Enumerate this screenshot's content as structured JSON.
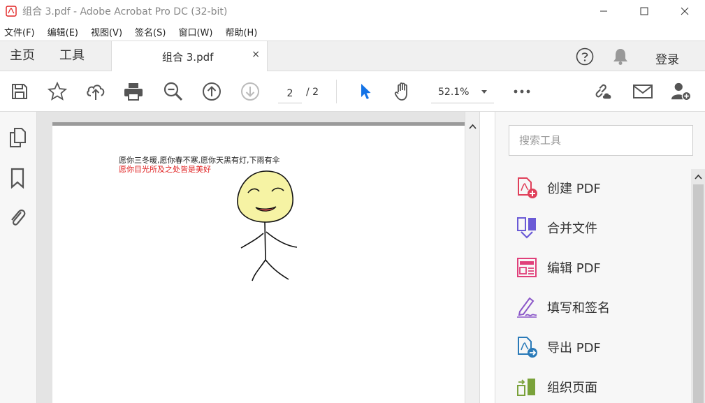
{
  "window": {
    "title": "组合 3.pdf - Adobe Acrobat Pro DC (32-bit)"
  },
  "menu": [
    {
      "label": "文件(F)"
    },
    {
      "label": "编辑(E)"
    },
    {
      "label": "视图(V)"
    },
    {
      "label": "签名(S)"
    },
    {
      "label": "窗口(W)"
    },
    {
      "label": "帮助(H)"
    }
  ],
  "tabs": {
    "home": "主页",
    "tools": "工具",
    "document": "组合 3.pdf",
    "close": "×"
  },
  "header_right": {
    "login": "登录"
  },
  "toolbar": {
    "current_page": "2",
    "total_pages": "/ 2",
    "zoom": "52.1%"
  },
  "document": {
    "line1": "愿你三冬暖,愿你春不寒,愿你天黑有灯,下雨有伞",
    "line2": "愿你目光所及之处皆是美好"
  },
  "tools_pane": {
    "search_placeholder": "搜索工具",
    "tools": [
      {
        "label": "创建 PDF",
        "icon": "create-pdf-icon",
        "color": "#e0405a"
      },
      {
        "label": "合并文件",
        "icon": "combine-files-icon",
        "color": "#6a5ad6"
      },
      {
        "label": "编辑 PDF",
        "icon": "edit-pdf-icon",
        "color": "#e0407a"
      },
      {
        "label": "填写和签名",
        "icon": "fill-sign-icon",
        "color": "#8a56c8"
      },
      {
        "label": "导出 PDF",
        "icon": "export-pdf-icon",
        "color": "#2a7ab8"
      },
      {
        "label": "组织页面",
        "icon": "organize-pages-icon",
        "color": "#7aa23a"
      }
    ]
  },
  "colors": {
    "accent_blue": "#1473e6",
    "adobe_red": "#e02020"
  }
}
